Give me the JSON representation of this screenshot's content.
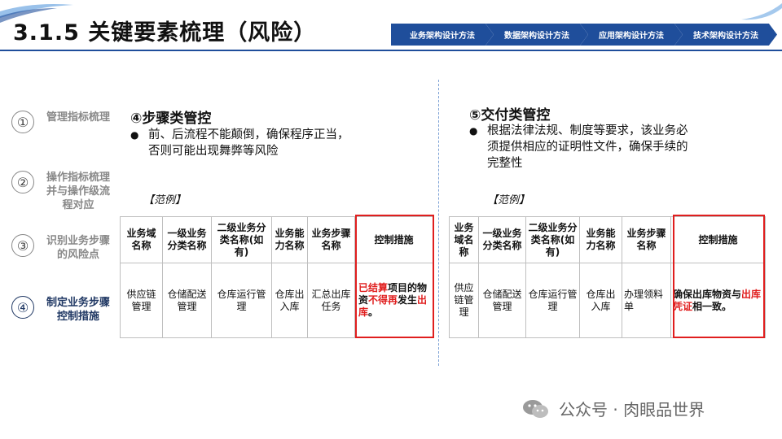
{
  "header": {
    "title": "3.1.5 关键要素梳理（风险）",
    "nav": [
      "业务架构设计方法",
      "数据架构设计方法",
      "应用架构设计方法",
      "技术架构设计方法"
    ],
    "accent_color": "#1f4e9b"
  },
  "steps": [
    {
      "num": "①",
      "label": "管理指标梳理"
    },
    {
      "num": "②",
      "label": "操作指标梳理并与操作级流程对应"
    },
    {
      "num": "③",
      "label": "识别业务步骤的风险点"
    },
    {
      "num": "④",
      "label": "制定业务步骤控制措施",
      "active": true
    }
  ],
  "left_panel": {
    "title": "④步骤类管控",
    "bullet_line1": "前、后流程不能颠倒，确保程序正当，",
    "bullet_line2": "否则可能出现舞弊等风险",
    "example": "【范例】",
    "headers": [
      "业务域名称",
      "一级业务分类名称",
      "二级业务分类名称(如有)",
      "业务能力名称",
      "业务步骤名称",
      "控制措施"
    ],
    "row": [
      "供应链管理",
      "仓储配送管理",
      "仓库运行管理",
      "仓库出入库",
      "汇总出库任务"
    ],
    "control": [
      {
        "text": "已结算",
        "red": true
      },
      {
        "text": "项目的物资",
        "red": false
      },
      {
        "text": "不得再",
        "red": true
      },
      {
        "text": "发生",
        "red": false
      },
      {
        "text": "出库",
        "red": true
      },
      {
        "text": "。",
        "red": false
      }
    ]
  },
  "right_panel": {
    "title": "⑤交付类管控",
    "bullet_line1": "根据法律法规、制度等要求，该业务必",
    "bullet_line2": "须提供相应的证明性文件，确保手续的",
    "bullet_line3": "完整性",
    "example": "【范例】",
    "headers": [
      "业务域名称",
      "一级业务分类名称",
      "二级业务分类名称(如有)",
      "业务能力名称",
      "业务步骤名称",
      "控制措施"
    ],
    "row": [
      "供应链管理",
      "仓储配送管理",
      "仓库运行管理",
      "仓库出入库",
      "办理领料单"
    ],
    "control": [
      {
        "text": "确保出库物资与",
        "red": false
      },
      {
        "text": "出库凭证",
        "red": true
      },
      {
        "text": "相一致。",
        "red": false
      }
    ]
  },
  "watermark": "公众号 · 肉眼品世界",
  "highlight_color": "#e01e1e"
}
